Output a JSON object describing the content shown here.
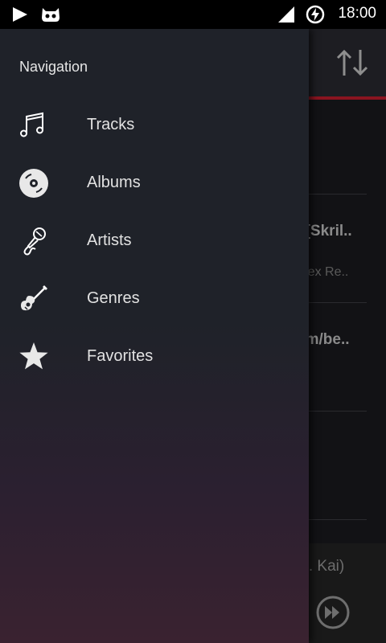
{
  "status_bar": {
    "time": "18:00"
  },
  "drawer": {
    "header": "Navigation",
    "items": [
      {
        "label": "Tracks",
        "icon": "music-note-icon"
      },
      {
        "label": "Albums",
        "icon": "album-disc-icon"
      },
      {
        "label": "Artists",
        "icon": "microphone-icon"
      },
      {
        "label": "Genres",
        "icon": "guitar-icon"
      },
      {
        "label": "Favorites",
        "icon": "star-icon"
      }
    ]
  },
  "background_list": {
    "rows": [
      {
        "title": ") [Skril..",
        "subtitle": "illex Re.."
      },
      {
        "title": "om/be..",
        "subtitle": ""
      }
    ]
  },
  "player": {
    "title": "at. Kai)"
  },
  "colors": {
    "accent": "#8a1420",
    "drawer_top": "#1f2229",
    "drawer_bottom": "#3a2230"
  }
}
